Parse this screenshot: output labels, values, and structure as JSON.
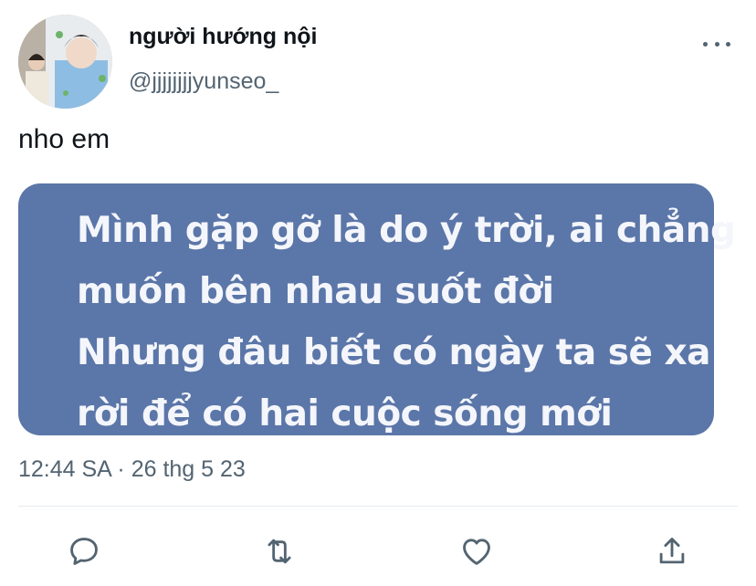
{
  "user": {
    "display_name": "người hướng nội",
    "handle": "@jjjjjjjjyunseo_",
    "avatar": "profile-photo"
  },
  "tweet": {
    "text": "nho em",
    "card_lines": [
      "Mình gặp gỡ là do ý trời, ai chẳng",
      "muốn bên nhau suốt đời",
      "Nhưng đâu biết có ngày ta sẽ xa",
      "rời để có hai cuộc sống mới"
    ],
    "card_color": "#5b76a8",
    "timestamp": "12:44 SA · 26 thg 5 23"
  },
  "actions": [
    {
      "name": "reply",
      "icon": "reply-icon"
    },
    {
      "name": "retweet",
      "icon": "retweet-icon"
    },
    {
      "name": "like",
      "icon": "heart-icon"
    },
    {
      "name": "share",
      "icon": "share-icon"
    }
  ],
  "colors": {
    "text": "#0f1419",
    "secondary": "#536471",
    "divider": "#e6ebee"
  }
}
